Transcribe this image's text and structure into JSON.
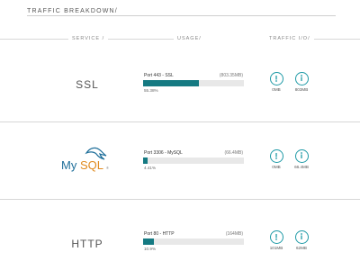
{
  "page": {
    "title": "TRAFFIC BREAKDOWN/"
  },
  "columns": {
    "service": "SERVICE /",
    "usage": "USAGE/",
    "traffic": "TRAFFIC I/O/"
  },
  "accent_color": "#157a82",
  "icon_color": "#1e9aa6",
  "rows": [
    {
      "service": "SSL",
      "port_label": "Port 443 - SSL",
      "size": "(803.35MB)",
      "percent_text": "55.38%",
      "percent": 55.38,
      "traffic_in": "0MB",
      "traffic_out": "803MB"
    },
    {
      "service": "MySQL",
      "port_label": "Port 3306 - MySQL",
      "size": "(66.4MB)",
      "percent_text": "4.41%",
      "percent": 4.41,
      "traffic_in": "0MB",
      "traffic_out": "66.4MB"
    },
    {
      "service": "HTTP",
      "port_label": "Port 80 - HTTP",
      "size": "(164MB)",
      "percent_text": "10.9%",
      "percent": 10.9,
      "traffic_in": "101MB",
      "traffic_out": "62MB"
    }
  ]
}
